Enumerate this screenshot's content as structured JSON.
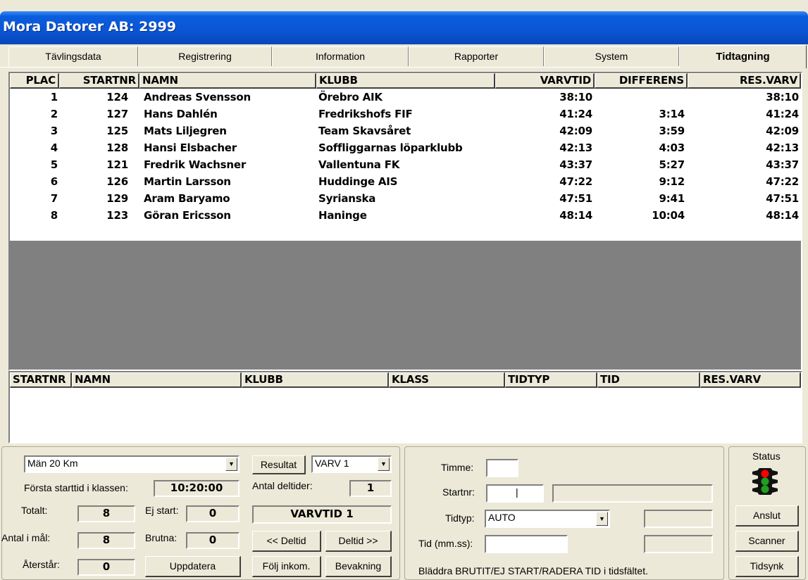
{
  "window": {
    "title": "Mora Datorer AB: 2999"
  },
  "tabs": [
    {
      "label": "Tävlingsdata"
    },
    {
      "label": "Registrering"
    },
    {
      "label": "Information"
    },
    {
      "label": "Rapporter"
    },
    {
      "label": "System"
    },
    {
      "label": "Tidtagning"
    }
  ],
  "results": {
    "columns": [
      "PLAC",
      "STARTNR",
      "NAMN",
      "KLUBB",
      "VARVTID",
      "DIFFERENS",
      "RES.VARV"
    ],
    "rows": [
      {
        "plac": "1",
        "startnr": "124",
        "namn": "Andreas Svensson",
        "klubb": "Örebro AIK",
        "varvtid": "38:10",
        "differens": "",
        "res_varv": "38:10"
      },
      {
        "plac": "2",
        "startnr": "127",
        "namn": "Hans Dahlén",
        "klubb": "Fredrikshofs FIF",
        "varvtid": "41:24",
        "differens": "3:14",
        "res_varv": "41:24"
      },
      {
        "plac": "3",
        "startnr": "125",
        "namn": "Mats Liljegren",
        "klubb": "Team Skavsåret",
        "varvtid": "42:09",
        "differens": "3:59",
        "res_varv": "42:09"
      },
      {
        "plac": "4",
        "startnr": "128",
        "namn": "Hansi Elsbacher",
        "klubb": "Soffliggarnas löparklubb",
        "varvtid": "42:13",
        "differens": "4:03",
        "res_varv": "42:13"
      },
      {
        "plac": "5",
        "startnr": "121",
        "namn": "Fredrik Wachsner",
        "klubb": "Vallentuna FK",
        "varvtid": "43:37",
        "differens": "5:27",
        "res_varv": "43:37"
      },
      {
        "plac": "6",
        "startnr": "126",
        "namn": "Martin Larsson",
        "klubb": "Huddinge AIS",
        "varvtid": "47:22",
        "differens": "9:12",
        "res_varv": "47:22"
      },
      {
        "plac": "7",
        "startnr": "129",
        "namn": "Aram Baryamo",
        "klubb": "Syrianska",
        "varvtid": "47:51",
        "differens": "9:41",
        "res_varv": "47:51"
      },
      {
        "plac": "8",
        "startnr": "123",
        "namn": "Göran Ericsson",
        "klubb": "Haninge",
        "varvtid": "48:14",
        "differens": "10:04",
        "res_varv": "48:14"
      }
    ]
  },
  "registrations": {
    "columns": [
      "STARTNR",
      "NAMN",
      "KLUBB",
      "KLASS",
      "TIDTYP",
      "TID",
      "RES.VARV"
    ]
  },
  "class_panel": {
    "class_select": "Män 20 Km",
    "first_start_label": "Första starttid i klassen:",
    "first_start_value": "10:20:00",
    "totalt_label": "Totalt:",
    "totalt_value": "8",
    "ej_start_label": "Ej start:",
    "ej_start_value": "0",
    "antal_i_mal_label": "Antal i mål:",
    "antal_i_mal_value": "8",
    "brutna_label": "Brutna:",
    "brutna_value": "0",
    "aterstar_label": "Återstår:",
    "aterstar_value": "0",
    "uppdatera": "Uppdatera",
    "resultat_button": "Resultat",
    "varv_select": "VARV 1",
    "antal_deltider_label": "Antal deltider:",
    "antal_deltider_value": "1",
    "varvtid_display": "VARVTID 1",
    "prev_deltid": "<< Deltid",
    "next_deltid": "Deltid >>",
    "folj_inkom": "Följ inkom.",
    "bevakning": "Bevakning"
  },
  "entry_panel": {
    "timme_label": "Timme:",
    "timme_value": "",
    "startnr_label": "Startnr:",
    "startnr_value": "|",
    "tidtyp_label": "Tidtyp:",
    "tidtyp_value": "AUTO",
    "tid_label": "Tid (mm.ss):",
    "tid_value": "",
    "hint": "Bläddra BRUTIT/EJ START/RADERA TID i tidsfältet."
  },
  "status_panel": {
    "title": "Status",
    "anslut": "Anslut",
    "scanner": "Scanner",
    "tidsynk": "Tidsynk"
  },
  "colors": {
    "title_bar": "#0a55d4",
    "window_bg": "#ece9d8",
    "list_bg": "#ffffff",
    "empty_area": "#808080",
    "light_red": "#ff0000",
    "light_green": "#1f9e1f"
  }
}
